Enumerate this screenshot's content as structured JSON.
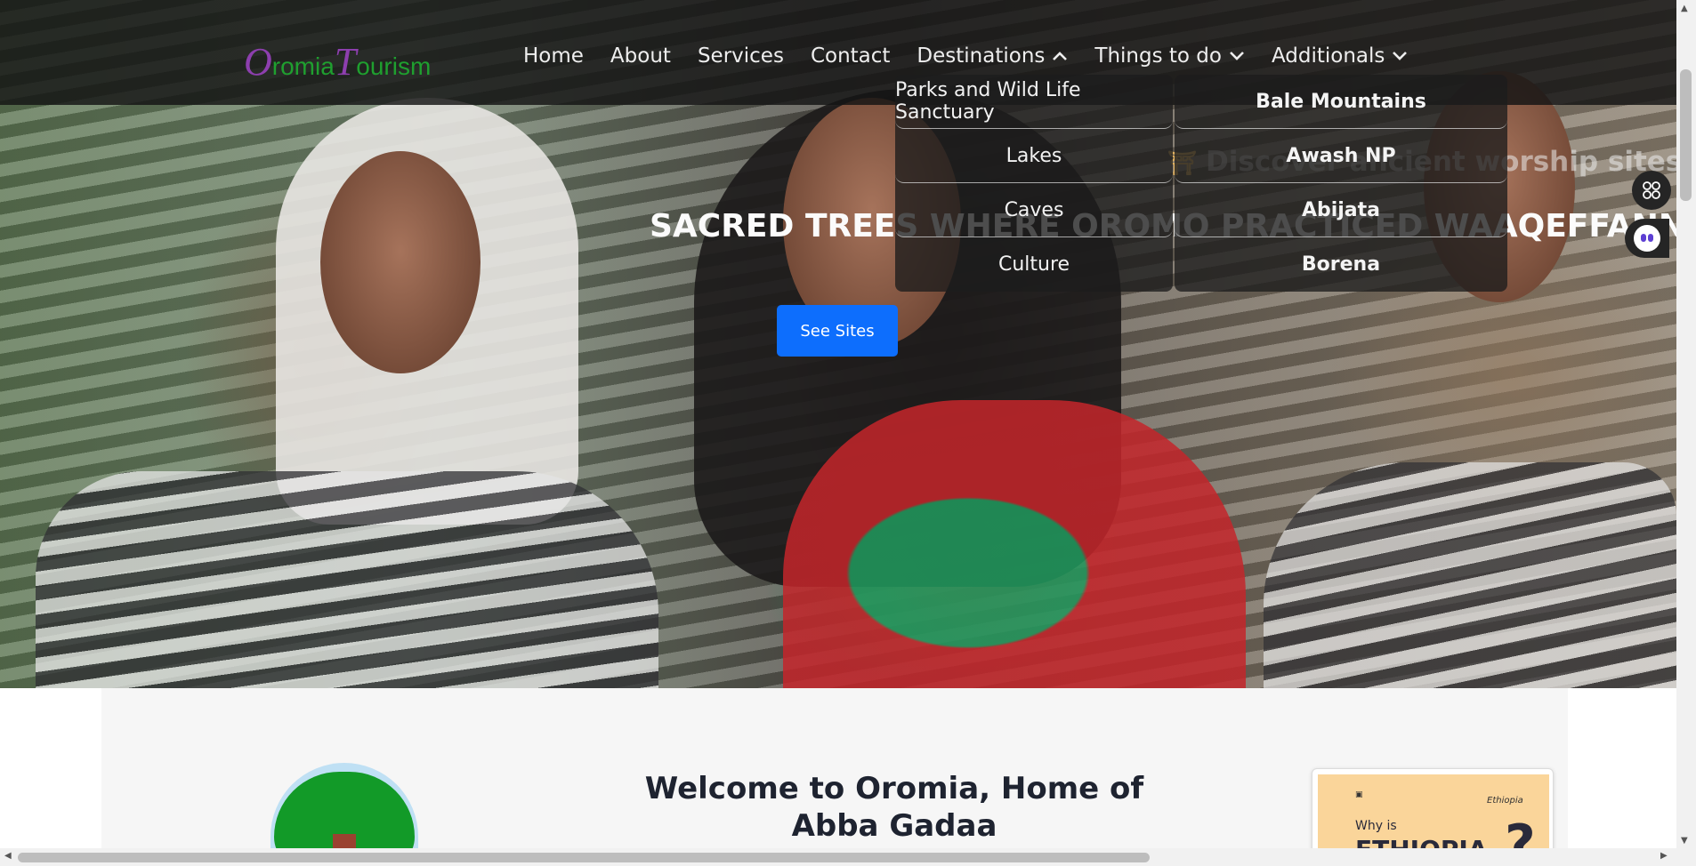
{
  "logo": {
    "o": "O",
    "romia": "romia",
    "t": "T",
    "ourism": "ourism"
  },
  "nav": [
    {
      "label": "Home"
    },
    {
      "label": "About"
    },
    {
      "label": "Services"
    },
    {
      "label": "Contact"
    },
    {
      "label": "Destinations",
      "chevron": "^",
      "open": true
    },
    {
      "label": "Things to do",
      "chevron": "v"
    },
    {
      "label": "Additionals",
      "chevron": "v"
    }
  ],
  "dropdown": {
    "left": [
      "Parks and Wild Life Sanctuary",
      "Lakes",
      "Caves",
      "Culture"
    ],
    "right": [
      "Bale Mountains",
      "Awash NP",
      "Abijata",
      "Borena"
    ]
  },
  "hero": {
    "subtitle": "Discover ancient worship sites",
    "title": "SACRED TREES WHERE OROMO PRACTICED WAAQEFFANNAA",
    "button": "See Sites"
  },
  "content": {
    "welcome": "Welcome to Oromia, Home of Abba Gadaa"
  },
  "promo": {
    "why": "Why is",
    "ethiopia": "ETHIOPIA",
    "q": "?",
    "brand": "Ethiopia"
  },
  "colors": {
    "accent": "#0d6efd",
    "logo_green": "#1f9f2f",
    "logo_purple": "#8d3fae"
  }
}
